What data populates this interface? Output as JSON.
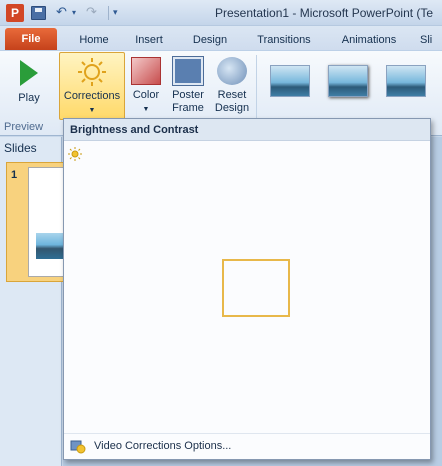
{
  "window": {
    "app_icon": "P",
    "title": "Presentation1  -  Microsoft PowerPoint (Te"
  },
  "quick_access": {
    "undo_icon": "undo-icon",
    "redo_icon": "redo-icon",
    "customize_icon": "chevron-down-icon"
  },
  "tabs": {
    "file": "File",
    "items": [
      "Home",
      "Insert",
      "Design",
      "Transitions",
      "Animations",
      "Sli"
    ]
  },
  "ribbon": {
    "play": "Play",
    "corrections": "Corrections",
    "color": "Color",
    "poster_frame_1": "Poster",
    "poster_frame_2": "Frame",
    "reset_design_1": "Reset",
    "reset_design_2": "Design",
    "preview_group": "Preview"
  },
  "slides_pane": {
    "tab_label": "Slides",
    "slide_number": "1"
  },
  "dropdown": {
    "header": "Brightness and Contrast",
    "footer_label": "Video Corrections Options...",
    "grid_rows": 5,
    "grid_cols": 5,
    "selected_row": 2,
    "selected_col": 2
  },
  "colors": {
    "file_tab": "#d24726",
    "highlight": "#ffd969",
    "selection_border": "#e8b84a"
  }
}
